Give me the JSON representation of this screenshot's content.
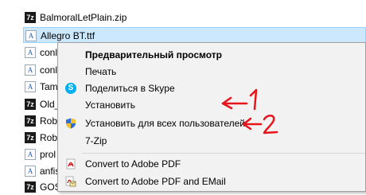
{
  "files": [
    {
      "name": "BalmoralLetPlain.zip",
      "icon": "zip-icon",
      "icon_text": "7z"
    },
    {
      "name": "Allegro BT.ttf",
      "icon": "font-icon",
      "icon_text": "A",
      "selected": true
    },
    {
      "name": "conl",
      "icon": "font-icon",
      "icon_text": "A"
    },
    {
      "name": "conl",
      "icon": "font-icon",
      "icon_text": "A"
    },
    {
      "name": "Tam",
      "icon": "font-icon",
      "icon_text": "A"
    },
    {
      "name": "Old_",
      "icon": "zip-icon",
      "icon_text": "7z"
    },
    {
      "name": "Rob",
      "icon": "zip-icon",
      "icon_text": "7z"
    },
    {
      "name": "Rob",
      "icon": "zip-icon",
      "icon_text": "7z"
    },
    {
      "name": "prol",
      "icon": "font-icon",
      "icon_text": "A"
    },
    {
      "name": "anfis",
      "icon": "font-icon",
      "icon_text": "A"
    },
    {
      "name": "GOS",
      "icon": "zip-icon",
      "icon_text": "7z"
    }
  ],
  "context_menu": {
    "preview": "Предварительный просмотр",
    "print": "Печать",
    "share_skype": "Поделиться в Skype",
    "install": "Установить",
    "install_all_users": "Установить для всех пользователей",
    "sevenzip": "7-Zip",
    "convert_pdf": "Convert to Adobe PDF",
    "convert_pdf_email": "Convert to Adobe PDF and EMail"
  },
  "annotations": {
    "arrow1_number": "1",
    "arrow2_number": "2",
    "color": "#e8141b"
  },
  "colors": {
    "selection_bg": "#cce8ff",
    "menu_bg": "#f2f2f2",
    "skype": "#00aff0"
  }
}
